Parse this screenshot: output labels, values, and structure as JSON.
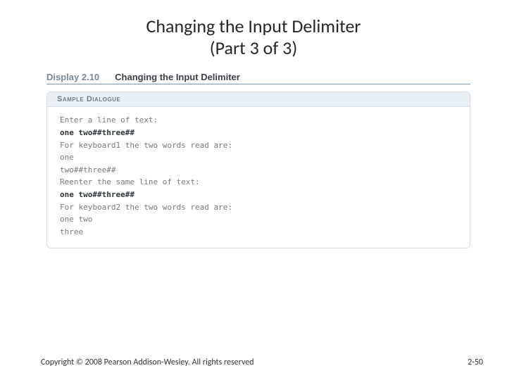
{
  "title": {
    "line1": "Changing the Input Delimiter",
    "line2": "(Part 3 of 3)"
  },
  "figure": {
    "display_label": "Display 2.10",
    "display_title": "Changing the Input Delimiter",
    "sample_header": "Sample Dialogue",
    "lines": [
      {
        "text": "Enter a line of text:",
        "user": false
      },
      {
        "text": "one two##three##",
        "user": true
      },
      {
        "text": "For keyboard1 the two words read are:",
        "user": false
      },
      {
        "text": "one",
        "user": false
      },
      {
        "text": "two##three##",
        "user": false
      },
      {
        "text": "Reenter the same line of text:",
        "user": false
      },
      {
        "text": "one two##three##",
        "user": true
      },
      {
        "text": "For keyboard2 the two words read are:",
        "user": false
      },
      {
        "text": "one two",
        "user": false
      },
      {
        "text": "three",
        "user": false
      }
    ]
  },
  "footer": {
    "copyright": "Copyright © 2008 Pearson Addison-Wesley. All rights reserved",
    "page": "2-50"
  }
}
